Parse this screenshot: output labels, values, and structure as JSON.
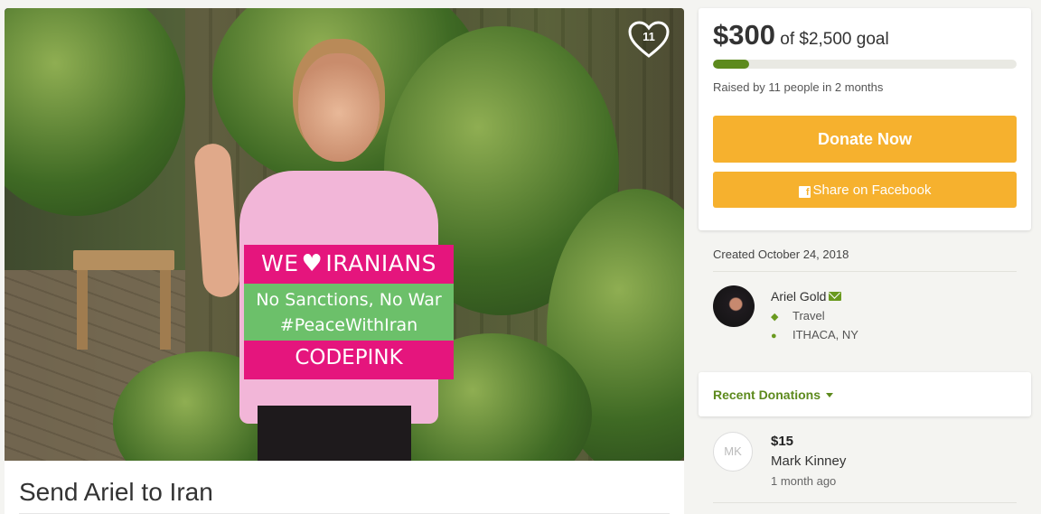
{
  "hero": {
    "image_alt": "Woman holding sign",
    "sign": {
      "line1_left": "WE",
      "line1_right": "IRANIANS",
      "line2": "No Sanctions, No War",
      "line3": "#PeaceWithIran",
      "line4": "CODEPINK"
    },
    "heart_count": "11"
  },
  "campaign": {
    "title": "Send Ariel to Iran"
  },
  "goal": {
    "raised": "$300",
    "of_goal": "of $2,500 goal",
    "progress_fraction": 0.12,
    "raised_by": "Raised by 11 people in 2 months",
    "donate_label": "Donate Now",
    "share_label": "Share on Facebook"
  },
  "details": {
    "created": "Created October 24, 2018",
    "organizer": "Ariel Gold",
    "category": "Travel",
    "location": "ITHACA, NY"
  },
  "recent": {
    "label": "Recent Donations",
    "items": [
      {
        "initials": "MK",
        "amount": "$15",
        "name": "Mark Kinney",
        "time": "1 month ago"
      }
    ]
  },
  "colors": {
    "accent_green": "#5d8a1d",
    "button_orange": "#f6b12e",
    "sign_pink": "#e5157d",
    "sign_green": "#6cc06a"
  }
}
